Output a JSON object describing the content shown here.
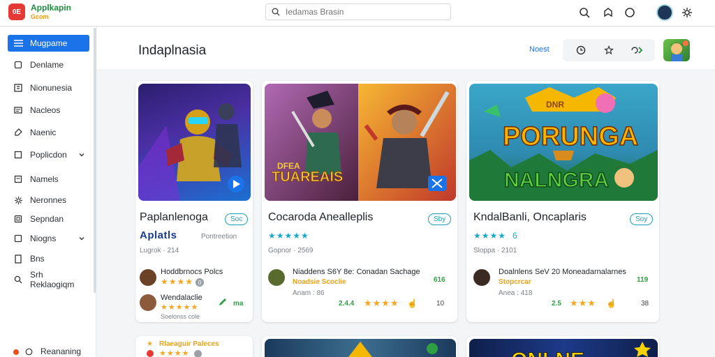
{
  "app": {
    "logo_text": "0E",
    "name": "Applkapin",
    "name_sub": "Gcom"
  },
  "search": {
    "placeholder": "Iedamas Brasin"
  },
  "sidebar": {
    "items": [
      {
        "label": "Mugpame",
        "icon": "menu-icon",
        "active": true
      },
      {
        "label": "Denlame",
        "icon": "home-icon"
      },
      {
        "label": "Nionunesia",
        "icon": "grid-icon"
      },
      {
        "label": "Nacleos",
        "icon": "list-icon"
      },
      {
        "label": "Naenic",
        "icon": "tag-icon"
      },
      {
        "label": "Poplicdon",
        "icon": "bookmark-icon",
        "chevron": true
      },
      {
        "label": "Namels",
        "icon": "doc-icon"
      },
      {
        "label": "Neronnes",
        "icon": "gear-icon"
      },
      {
        "label": "Sepndan",
        "icon": "box-icon"
      },
      {
        "label": "Niogns",
        "icon": "folder-icon",
        "chevron": true
      },
      {
        "label": "Bns",
        "icon": "file-icon"
      },
      {
        "label": "Srh Reklaogiqm",
        "icon": "search-icon"
      }
    ],
    "footer": "Reananing"
  },
  "header": {
    "title": "Indaplnasia",
    "newest_label": "Noest"
  },
  "cards": [
    {
      "title": "Paplanlenoga",
      "pill": "Soc",
      "subtitle": "Aplatls",
      "secondary": "Pontreetion",
      "meta": "Lugrok · 214",
      "reviews": [
        {
          "name": "Hoddbrnocs Polcs",
          "stars": "★★★★",
          "badge": "0"
        },
        {
          "name": "Wendalaclie",
          "stars": "★★★★★",
          "tag": "Soelonss cole",
          "num": "ma"
        }
      ]
    },
    {
      "title": "Cocaroda Anealleplis",
      "pill": "Sby",
      "stars": "★★★★★",
      "meta": "Gopnor · 2569",
      "thumb_left_caption": "DFEA TUAREAIS",
      "reviews": [
        {
          "name": "Niaddens S6Y 8e: Conadan Sachage",
          "tag": "Noadsie Scoclie",
          "num": "616",
          "sub": "Anam : 86"
        },
        {
          "lead": "2.4.4",
          "stars": "★★★★",
          "thumb": "☝",
          "num": "10"
        }
      ]
    },
    {
      "title": "KndalBanli, Oncaplaris",
      "pill": "Soy",
      "stars": "★★★★",
      "stars_score": "6",
      "meta": "Sloppa · 2101",
      "thumb_words": {
        "top": "PORUNGA",
        "bottom": "NALNGRA",
        "tag": "DNR"
      },
      "reviews": [
        {
          "name": "Doalnlens SeV 20 Moneadarnalarnes",
          "tag": "Stopcrcar",
          "num": "119",
          "sub": "Anea : 418"
        },
        {
          "lead": "2.5",
          "stars": "★★★",
          "thumb": "☝",
          "num": "38"
        }
      ]
    }
  ],
  "bottom_cards": [
    {
      "title": "Rlaeaguir Paleces"
    },
    {
      "title": ""
    },
    {
      "title": "ONLNE"
    }
  ],
  "colors": {
    "accent": "#1a73e8",
    "star": "#f5a623",
    "pill": "#1aa1b5"
  }
}
